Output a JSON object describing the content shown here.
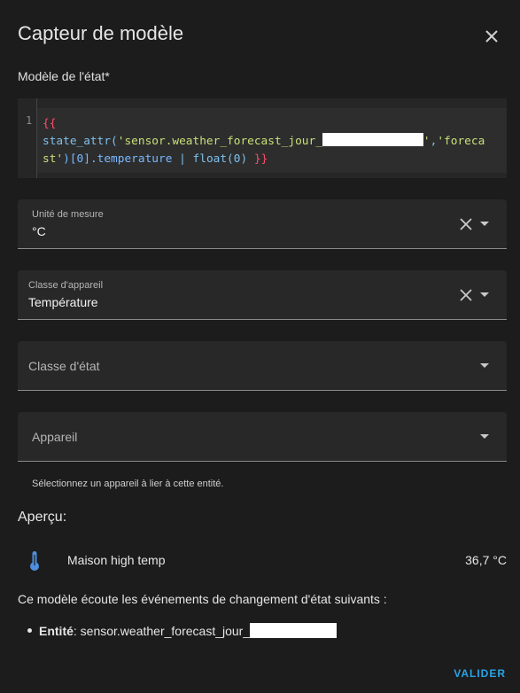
{
  "dialog": {
    "title": "Capteur de modèle",
    "close_icon": "close-icon"
  },
  "state_template": {
    "label": "Modèle de l'état*",
    "line_number": "1",
    "code": {
      "open": "{{",
      "fn": "state_attr",
      "paren_open": "(",
      "arg1": "'sensor.weather_forecast_jour_",
      "arg1_end": "'",
      "comma": ",",
      "arg2_a": "'foreca",
      "arg2_b": "st'",
      "index": ")[0].temperature",
      "pipe": " | ",
      "filter": "float(0)",
      "close": " }}"
    }
  },
  "fields": {
    "unit": {
      "label": "Unité de mesure",
      "value": "°C"
    },
    "device_class": {
      "label": "Classe d'appareil",
      "value": "Température"
    },
    "state_class": {
      "placeholder": "Classe d'état"
    },
    "device": {
      "placeholder": "Appareil",
      "helper": "Sélectionnez un appareil à lier à cette entité."
    }
  },
  "preview": {
    "heading": "Aperçu:",
    "icon": "thermometer-icon",
    "entity_name": "Maison high temp",
    "entity_value": "36,7 °C",
    "listen_text": "Ce modèle écoute les événements de changement d'état suivants :",
    "entity_label": "Entité",
    "entity_separator": ": ",
    "entity_id": "sensor.weather_forecast_jour_"
  },
  "actions": {
    "submit": "VALIDER"
  },
  "colors": {
    "accent": "#2aa3e6",
    "background": "#1c1c1c",
    "field": "#282828",
    "icon": "#4e8fe0"
  }
}
